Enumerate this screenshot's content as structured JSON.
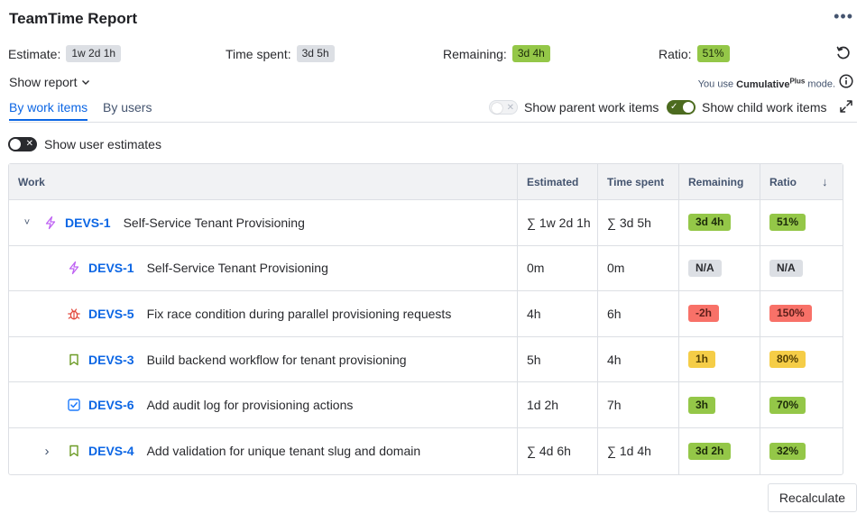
{
  "header": {
    "title": "TeamTime Report",
    "more_label": "•••"
  },
  "summary": {
    "estimate_label": "Estimate:",
    "estimate_value": "1w 2d 1h",
    "spent_label": "Time spent:",
    "spent_value": "3d 5h",
    "remaining_label": "Remaining:",
    "remaining_value": "3d 4h",
    "ratio_label": "Ratio:",
    "ratio_value": "51%"
  },
  "controls": {
    "show_report": "Show report",
    "mode_prefix": "You use",
    "mode_name": "Cumulative",
    "mode_sup": "Plus",
    "mode_suffix": "mode.",
    "tabs": [
      "By work items",
      "By users"
    ],
    "show_parent": "Show parent work items",
    "show_parent_on": false,
    "show_child": "Show child work items",
    "show_child_on": true,
    "show_user_estimates": "Show user estimates",
    "show_user_estimates_on": false
  },
  "table": {
    "columns": [
      "Work",
      "Estimated",
      "Time spent",
      "Remaining",
      "Ratio"
    ],
    "sort_indicator": "↓",
    "rows": [
      {
        "expander": "˅",
        "icon": "epic-icon",
        "key": "DEVS-1",
        "summary": "Self-Service Tenant Provisioning",
        "estimated": "∑ 1w 2d 1h",
        "spent": "∑ 3d 5h",
        "remaining": "3d 4h",
        "remaining_status": "green",
        "ratio": "51%",
        "ratio_status": "green"
      },
      {
        "expander": "",
        "icon": "epic-icon",
        "key": "DEVS-1",
        "summary": "Self-Service Tenant Provisioning",
        "estimated": "0m",
        "spent": "0m",
        "remaining": "N/A",
        "remaining_status": "grey",
        "ratio": "N/A",
        "ratio_status": "grey"
      },
      {
        "expander": "",
        "icon": "bug-icon",
        "key": "DEVS-5",
        "summary": "Fix race condition during parallel provisioning requests",
        "estimated": "4h",
        "spent": "6h",
        "remaining": "-2h",
        "remaining_status": "red",
        "ratio": "150%",
        "ratio_status": "red"
      },
      {
        "expander": "",
        "icon": "story-icon",
        "key": "DEVS-3",
        "summary": "Build backend workflow for tenant provisioning",
        "estimated": "5h",
        "spent": "4h",
        "remaining": "1h",
        "remaining_status": "yellow",
        "ratio": "80%",
        "ratio_status": "yellow"
      },
      {
        "expander": "",
        "icon": "task-icon",
        "key": "DEVS-6",
        "summary": "Add audit log for provisioning actions",
        "estimated": "1d 2h",
        "spent": "7h",
        "remaining": "3h",
        "remaining_status": "green",
        "ratio": "70%",
        "ratio_status": "green"
      },
      {
        "expander": "›",
        "icon": "story-icon",
        "key": "DEVS-4",
        "summary": "Add validation for unique tenant slug and domain",
        "estimated": "∑ 4d 6h",
        "spent": "∑ 1d 4h",
        "remaining": "3d 2h",
        "remaining_status": "green",
        "ratio": "32%",
        "ratio_status": "green"
      }
    ]
  },
  "footer": {
    "recalculate_label": "Recalculate"
  },
  "colors": {
    "accent": "#0c66e4",
    "green": "#94c748",
    "red": "#f87168",
    "yellow": "#f5cd47",
    "grey": "#dcdfe4"
  }
}
